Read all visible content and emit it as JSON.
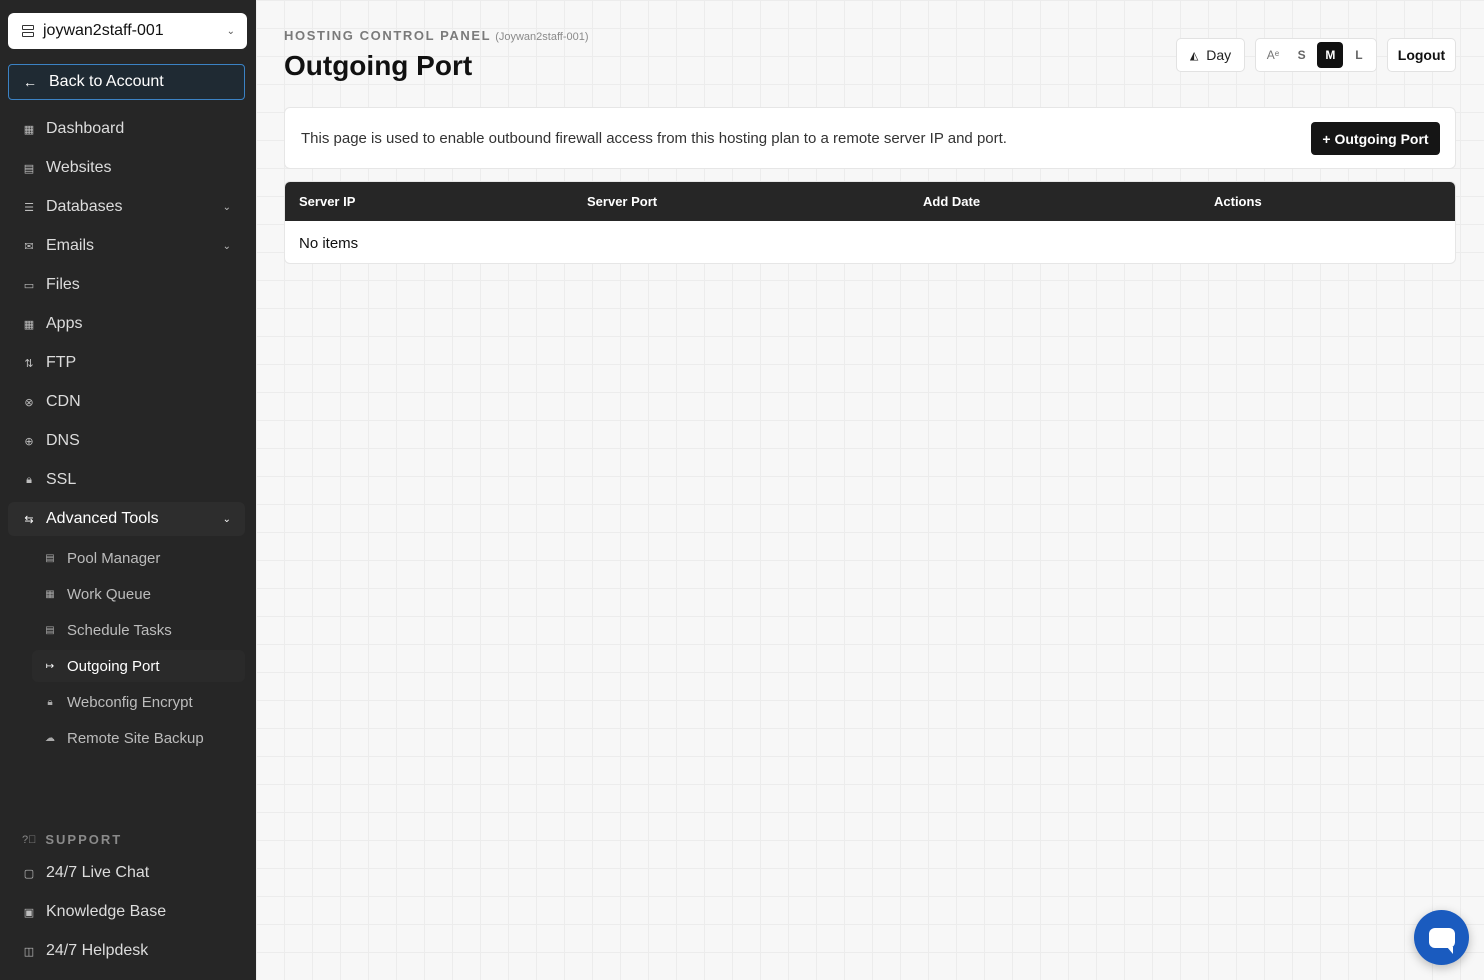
{
  "sidebar": {
    "account": {
      "label": "joywan2staff-001",
      "icon": "server-icon"
    },
    "back_label": "Back to Account",
    "items": [
      {
        "label": "Dashboard",
        "icon": "grid-icon"
      },
      {
        "label": "Websites",
        "icon": "browser-icon"
      },
      {
        "label": "Databases",
        "icon": "database-icon"
      },
      {
        "label": "Emails",
        "icon": "mail-icon"
      },
      {
        "label": "Files",
        "icon": "folder-icon"
      },
      {
        "label": "Apps",
        "icon": "apps-icon"
      },
      {
        "label": "FTP",
        "icon": "transfer-icon"
      },
      {
        "label": "CDN",
        "icon": "cdn-icon"
      },
      {
        "label": "DNS",
        "icon": "globe-icon"
      },
      {
        "label": "SSL",
        "icon": "lock-icon"
      },
      {
        "label": "Advanced Tools",
        "icon": "tools-icon"
      }
    ],
    "sub_items": [
      {
        "label": "Pool Manager",
        "icon": "pool-icon"
      },
      {
        "label": "Work Queue",
        "icon": "queue-icon"
      },
      {
        "label": "Schedule Tasks",
        "icon": "calendar-icon"
      },
      {
        "label": "Outgoing Port",
        "icon": "port-icon"
      },
      {
        "label": "Webconfig Encrypt",
        "icon": "lock-icon"
      },
      {
        "label": "Remote Site Backup",
        "icon": "cloud-icon"
      }
    ],
    "support_title": "SUPPORT",
    "support_items": [
      {
        "label": "24/7 Live Chat",
        "icon": "chat-icon"
      },
      {
        "label": "Knowledge Base",
        "icon": "book-icon"
      },
      {
        "label": "24/7 Helpdesk",
        "icon": "helpdesk-icon"
      }
    ]
  },
  "header": {
    "eyebrow": "HOSTING CONTROL PANEL",
    "eyebrow_account": "(Joywan2staff-001)",
    "title": "Outgoing Port",
    "theme_label": "Day",
    "sizes": [
      "S",
      "M",
      "L"
    ],
    "size_selected": "M",
    "logout_label": "Logout"
  },
  "info": {
    "text": "This page is used to enable outbound firewall access from this hosting plan to a remote server IP and port.",
    "add_label": "+ Outgoing Port"
  },
  "table": {
    "columns": [
      "Server IP",
      "Server Port",
      "Add Date",
      "Actions"
    ],
    "empty_text": "No items"
  },
  "colors": {
    "sidebar_bg": "#262626",
    "accent_blue": "#1a5bbf",
    "primary_button": "#151515"
  }
}
